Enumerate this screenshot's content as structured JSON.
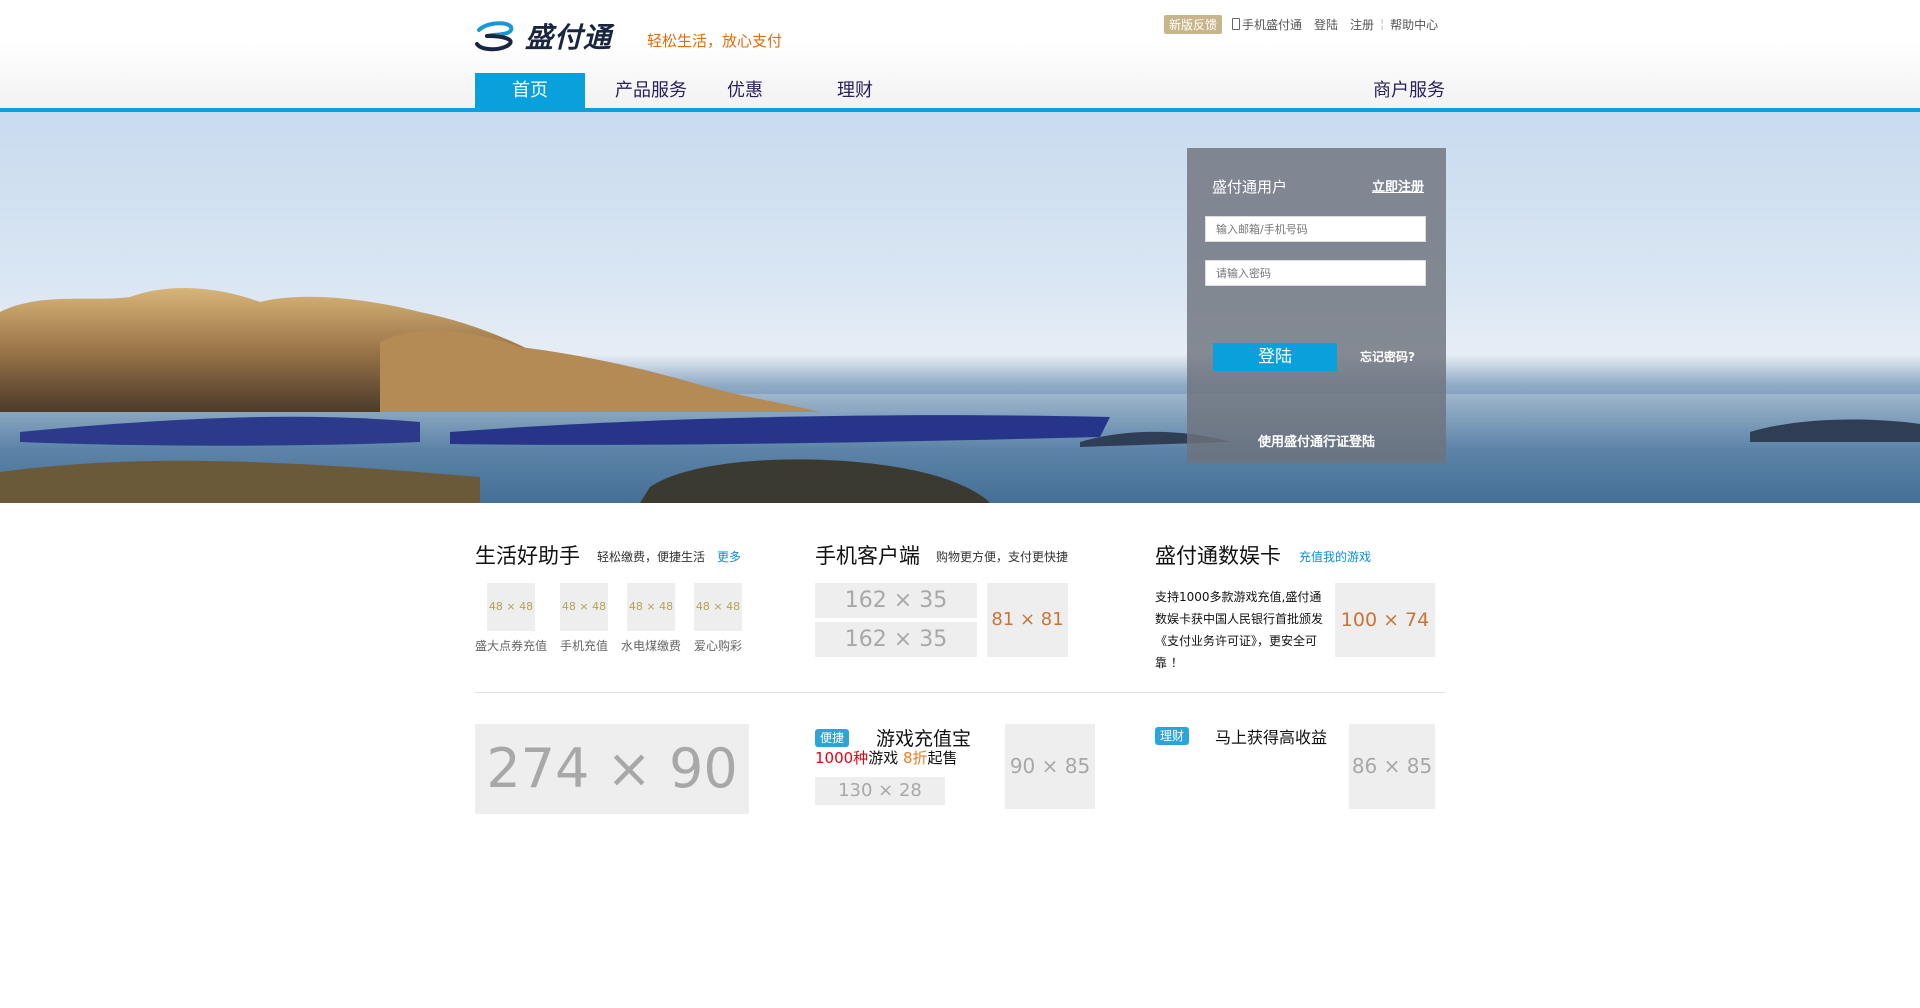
{
  "header": {
    "logo_text": "盛付通",
    "slogan": "轻松生活，放心支付",
    "feedback": "新版反馈",
    "mobile": "手机盛付通",
    "login": "登陆",
    "register": "注册",
    "help": "帮助中心"
  },
  "nav": {
    "items": [
      "首页",
      "产品服务",
      "优惠",
      "理财"
    ],
    "merchant": "商户服务"
  },
  "login": {
    "title": "盛付通用户",
    "register_now": "立即注册",
    "email_placeholder": "输入邮箱/手机号码",
    "password_placeholder": "请输入密码",
    "submit": "登陆",
    "forgot": "忘记密码?",
    "passport": "使用盛付通行证登陆"
  },
  "life": {
    "title": "生活好助手",
    "subtitle": "轻松缴费，便捷生活",
    "more": "更多",
    "icon_size": "48 × 48",
    "items": [
      "盛大点券充值",
      "手机充值",
      "水电煤缴费",
      "爱心购彩"
    ]
  },
  "mobile_client": {
    "title": "手机客户端",
    "subtitle": "购物更方便，支付更快捷",
    "ph1": "162 × 35",
    "ph2": "162 × 35",
    "ph3": "81 × 81"
  },
  "card": {
    "title": "盛付通数娱卡",
    "link": "充值我的游戏",
    "desc": "支持1000多款游戏充值,盛付通数娱卡获中国人民银行首批颁发《支付业务许可证》，更安全可靠 ！",
    "ph": "100 × 74"
  },
  "bottom": {
    "banner_ph": "274 × 90",
    "game": {
      "tag": "便捷",
      "title": "游戏充值宝",
      "count": "1000种",
      "word_game": "游戏",
      "discount": "8折",
      "sale": "起售",
      "ph_small": "130 × 28",
      "ph_img": "90 × 85"
    },
    "finance": {
      "tag": "理财",
      "title": "马上获得高收益",
      "ph_img": "86 × 85"
    }
  }
}
